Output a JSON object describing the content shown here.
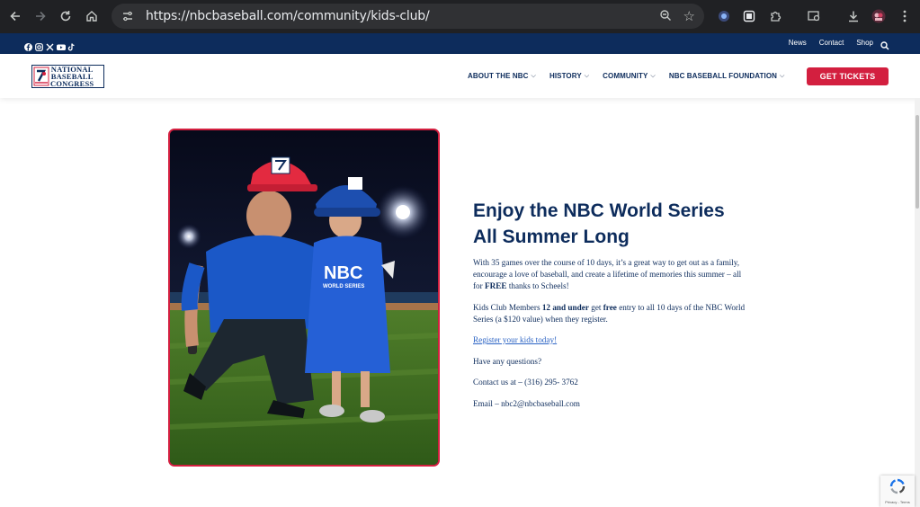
{
  "browser": {
    "url": "https://nbcbaseball.com/community/kids-club/"
  },
  "utility_bar": {
    "links": [
      "News",
      "Contact",
      "Shop"
    ]
  },
  "logo": {
    "line1": "NATIONAL",
    "line2": "BASEBALL",
    "line3": "CONGRESS"
  },
  "nav": {
    "items": [
      "ABOUT THE NBC",
      "HISTORY",
      "COMMUNITY",
      "NBC BASEBALL FOUNDATION"
    ],
    "cta": "GET TICKETS"
  },
  "content": {
    "heading_line1": "Enjoy the NBC World Series",
    "heading_line2": "All Summer Long",
    "p1_a": "With 35 games over the course of 10 days, it’s a great way to get out as a family, encourage a love of baseball, and create a lifetime of memories this summer – all for ",
    "p1_bold": "FREE",
    "p1_b": " thanks to Scheels!",
    "p2_a": "Kids Club Members ",
    "p2_bold1": "12 and under",
    "p2_b": " get ",
    "p2_bold2": "free",
    "p2_c": " entry to all 10 days of the NBC World Series (a $120 value) when they register.",
    "register_link": "Register your kids today!",
    "questions": "Have any questions?",
    "contact": "Contact us at – (316) 295- 3762",
    "email": "Email – nbc2@nbcbaseball.com"
  },
  "photo": {
    "jersey_text": "NBC",
    "jersey_subtext": "WORLD SERIES"
  },
  "recaptcha": {
    "text": "Privacy - Terms"
  },
  "colors": {
    "navy": "#0d2c5c",
    "red": "#d31f3f",
    "link": "#2b63c4",
    "chrome": "#202124"
  }
}
